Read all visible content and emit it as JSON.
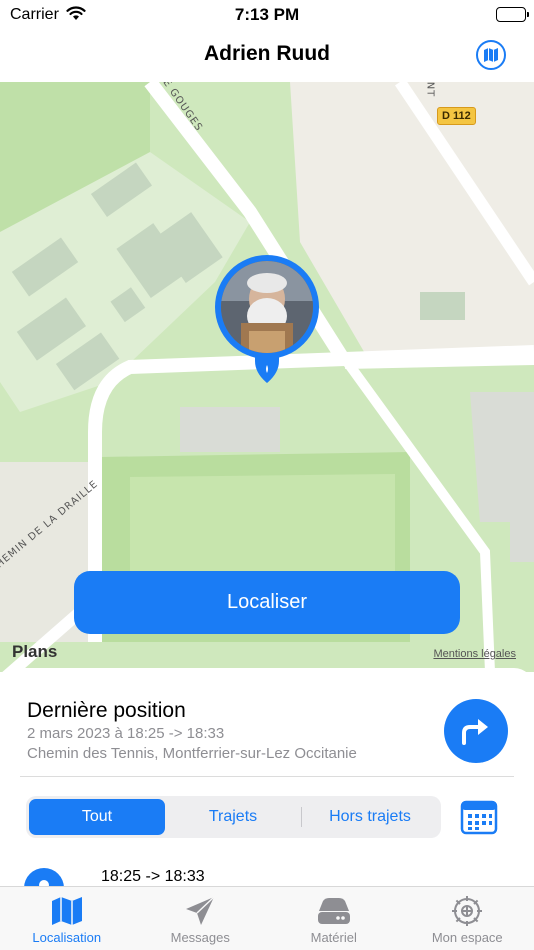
{
  "status_bar": {
    "carrier": "Carrier",
    "time": "7:13 PM"
  },
  "nav": {
    "title": "Adrien Ruud"
  },
  "map": {
    "road_sign": "D 112",
    "street_labels": [
      "E GOUGES",
      "NT",
      "CHEMIN DE LA DRAILLE"
    ],
    "locate_button": "Localiser",
    "apple_maps": "Plans",
    "legal": "Mentions légales"
  },
  "last_position": {
    "heading": "Dernière position",
    "date": "2 mars 2023 à 18:25 -> 18:33",
    "address": "Chemin des Tennis, Montferrier-sur-Lez Occitanie"
  },
  "filter": {
    "segments": [
      "Tout",
      "Trajets",
      "Hors trajets"
    ],
    "selected": "Tout"
  },
  "entries": [
    {
      "time": "18:25 -> 18:33"
    }
  ],
  "tabs": [
    {
      "label": "Localisation",
      "icon": "map-icon",
      "active": true
    },
    {
      "label": "Messages",
      "icon": "paper-plane-icon",
      "active": false
    },
    {
      "label": "Matériel",
      "icon": "device-icon",
      "active": false
    },
    {
      "label": "Mon espace",
      "icon": "gear-icon",
      "active": false
    }
  ],
  "colors": {
    "accent": "#1a7cf5",
    "map_green": "#cfe8bd",
    "secondary_text": "#8e8e93"
  }
}
